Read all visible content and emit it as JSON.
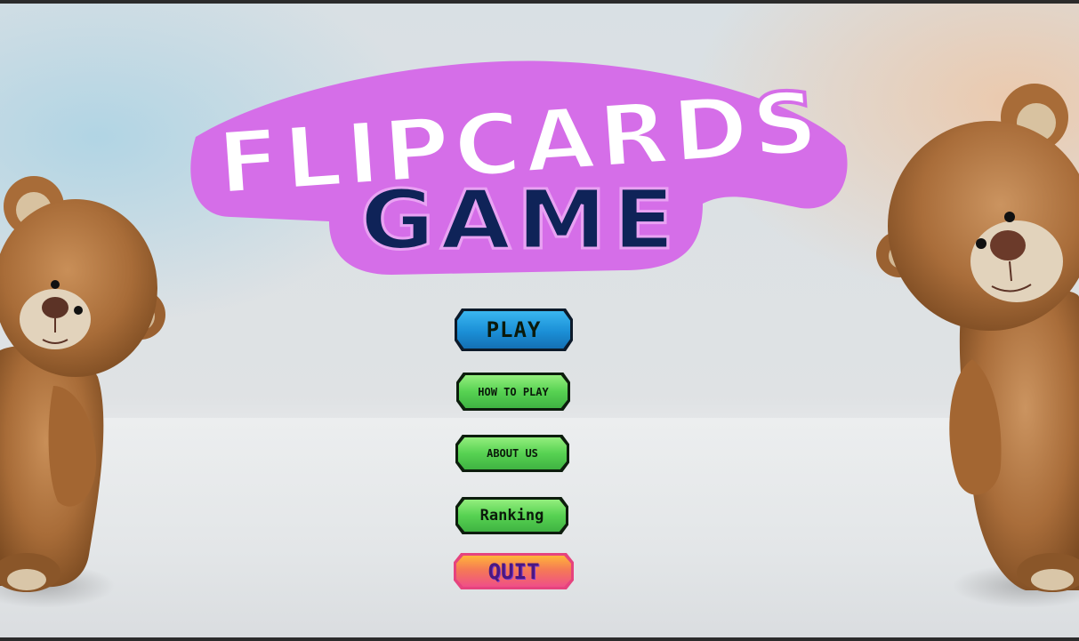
{
  "game": {
    "title_line1": "FLIPCARDS",
    "title_line2": "GAME"
  },
  "menu": {
    "play": "PLAY",
    "how_to_play": "HOW TO PLAY",
    "about_us": "ABOUT US",
    "ranking": "Ranking",
    "quit": "QUIT"
  },
  "colors": {
    "title_fill": "#ffffff",
    "title_outline": "#d56ee8",
    "subtitle_fill": "#0f2358",
    "play_button": "#1b8fd6",
    "menu_button": "#57d252",
    "quit_button": "#ef4f88"
  },
  "icons": [
    "teddy-bear-left-image",
    "teddy-bear-right-image"
  ]
}
